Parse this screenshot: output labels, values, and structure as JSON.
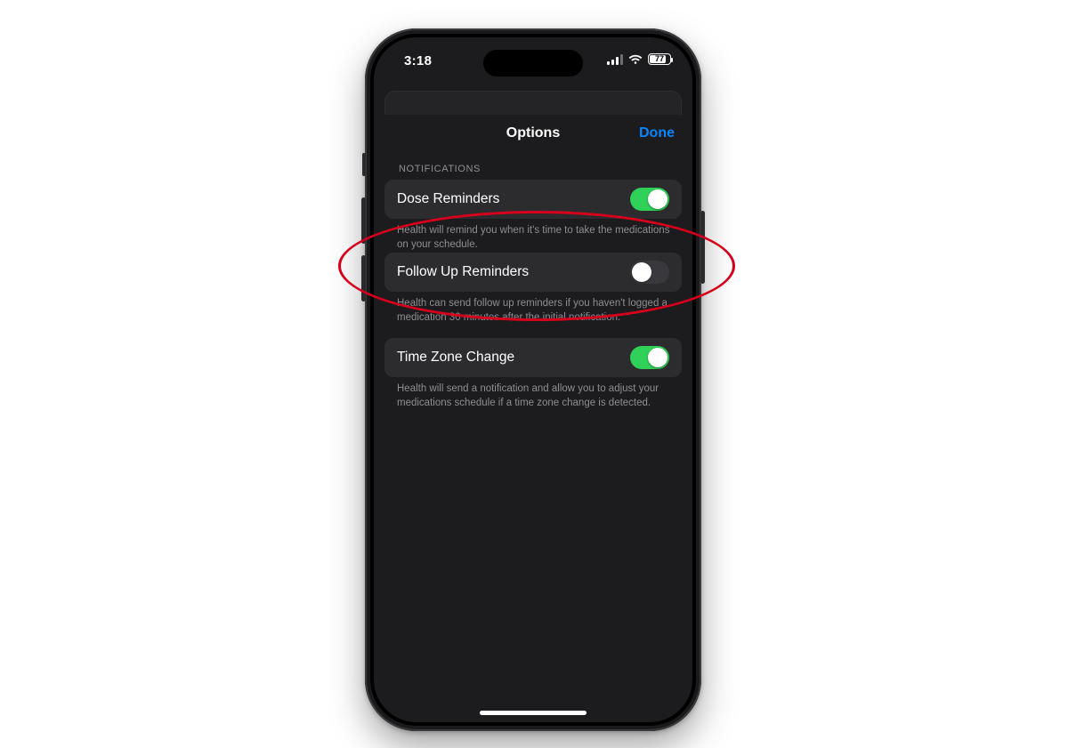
{
  "status": {
    "time": "3:18",
    "battery_percent": "77"
  },
  "sheet": {
    "title": "Options",
    "done": "Done"
  },
  "section_label": "NOTIFICATIONS",
  "rows": {
    "dose": {
      "label": "Dose Reminders",
      "footer": "Health will remind you when it's time to take the medications on your schedule.",
      "on": true
    },
    "followup": {
      "label": "Follow Up Reminders",
      "footer": "Health can send follow up reminders if you haven't logged a medication 30 minutes after the initial notification.",
      "on": false
    },
    "timezone": {
      "label": "Time Zone Change",
      "footer": "Health will send a notification and allow you to adjust your medications schedule if a time zone change is detected.",
      "on": true
    }
  },
  "annotation": {
    "highlight": "Follow Up Reminders row"
  }
}
